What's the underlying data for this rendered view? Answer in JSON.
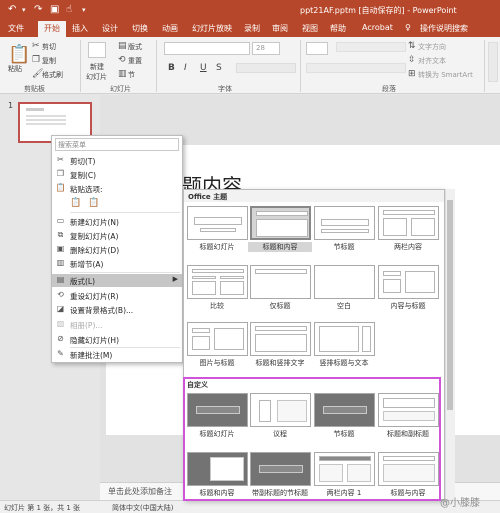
{
  "window": {
    "title": "ppt21AF.pptm [自动保存的] - PowerPoint",
    "accent": "#b7472a"
  },
  "quick_access": {
    "undo_icon": "undo-icon",
    "redo_icon": "redo-icon",
    "save_icon": "save-icon",
    "touch_icon": "touch-mode-icon"
  },
  "tabs": [
    "文件",
    "开始",
    "插入",
    "设计",
    "切换",
    "动画",
    "幻灯片放映",
    "录制",
    "审阅",
    "视图",
    "帮助",
    "Acrobat"
  ],
  "active_tab": "开始",
  "tell_me": "操作说明搜索",
  "ribbon": {
    "clipboard": {
      "paste": "粘贴",
      "cut": "剪切",
      "copy": "复制",
      "format_painter": "格式刷",
      "group": "剪贴板"
    },
    "slides": {
      "new_slide": "新建",
      "new_slide_2": "幻灯片",
      "layout": "版式",
      "reset": "重置",
      "section": "节",
      "group": "幻灯片"
    },
    "font": {
      "font_size": "28",
      "bold": "B",
      "italic": "I",
      "underline": "U",
      "strike": "S",
      "group": "字体"
    },
    "paragraph": {
      "text_direction": "文字方向",
      "align_text": "对齐文本",
      "smartart": "转换为 SmartArt",
      "group": "段落"
    }
  },
  "thumbnails": {
    "slide_number": "1"
  },
  "slide": {
    "title_fragment": "题内容"
  },
  "notes_placeholder": "单击此处添加备注",
  "status": {
    "slide_info": "幻灯片 第 1 张，共 1 张",
    "language": "简体中文(中国大陆)"
  },
  "context_menu": {
    "search_placeholder": "搜索菜单",
    "items": [
      {
        "label": "剪切(T)",
        "icon": "scissors-icon",
        "enabled": true
      },
      {
        "label": "复制(C)",
        "icon": "copy-icon",
        "enabled": true
      },
      {
        "label": "粘贴选项:",
        "icon": "paste-icon",
        "enabled": true
      },
      {
        "label": "新建幻灯片(N)",
        "icon": "new-slide-icon",
        "enabled": true
      },
      {
        "label": "复制幻灯片(A)",
        "icon": "duplicate-slide-icon",
        "enabled": true
      },
      {
        "label": "删除幻灯片(D)",
        "icon": "delete-slide-icon",
        "enabled": true
      },
      {
        "label": "新增节(A)",
        "icon": "section-icon",
        "enabled": true
      },
      {
        "label": "版式(L)",
        "icon": "layout-icon",
        "enabled": true,
        "submenu": true,
        "highlighted": true
      },
      {
        "label": "重设幻灯片(R)",
        "icon": "reset-slide-icon",
        "enabled": true
      },
      {
        "label": "设置背景格式(B)...",
        "icon": "background-icon",
        "enabled": true
      },
      {
        "label": "相册(P)...",
        "icon": "photo-album-icon",
        "enabled": false
      },
      {
        "label": "隐藏幻灯片(H)",
        "icon": "hide-slide-icon",
        "enabled": true
      },
      {
        "label": "新建批注(M)",
        "icon": "comment-icon",
        "enabled": true
      }
    ]
  },
  "layout_gallery": {
    "office_theme_label": "Office 主题",
    "office_layouts": [
      "标题幻灯片",
      "标题和内容",
      "节标题",
      "两栏内容",
      "比较",
      "仅标题",
      "空白",
      "内容与标题",
      "图片与标题",
      "标题和竖排文字",
      "竖排标题与文本"
    ],
    "selected_layout": "标题和内容",
    "custom_label": "自定义",
    "custom_layouts": [
      "标题幻灯片",
      "议程",
      "节标题",
      "标题和副标题",
      "标题和内容",
      "带副标题的节标题",
      "两栏内容 1",
      "标题与内容"
    ],
    "custom_highlight_color": "#d054d8"
  },
  "watermark": "@小膝膝"
}
